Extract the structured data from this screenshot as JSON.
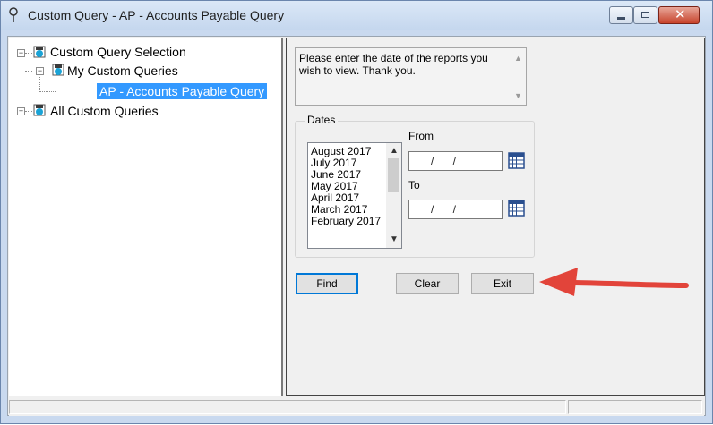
{
  "window": {
    "title": "Custom Query - AP - Accounts Payable Query",
    "controls": [
      "minimize",
      "maximize",
      "close"
    ]
  },
  "tree": {
    "root": {
      "label": "Custom Query Selection",
      "expander": "−"
    },
    "my_queries": {
      "label": "My Custom Queries",
      "expander": "−"
    },
    "selected_query": {
      "label": "AP - Accounts Payable Query"
    },
    "all_queries": {
      "label": "All Custom Queries",
      "expander": "+"
    }
  },
  "message": {
    "text": "Please enter the date of the reports you wish to view. Thank you."
  },
  "dates": {
    "group_label": "Dates",
    "list_items": [
      "August 2017",
      "July 2017",
      "June 2017",
      "May 2017",
      "April 2017",
      "March 2017",
      "February 2017"
    ],
    "from_label": "From",
    "to_label": "To",
    "from_value": "/ /",
    "to_value": "/ /"
  },
  "buttons": {
    "find": "Find",
    "clear": "Clear",
    "exit": "Exit"
  },
  "colors": {
    "selection": "#3399ff",
    "arrow": "#e2443a",
    "default_button_border": "#0078d7"
  },
  "icons": {
    "app": "query-pin-icon",
    "node": "query-folder-icon",
    "calendar": "calendar-icon"
  }
}
